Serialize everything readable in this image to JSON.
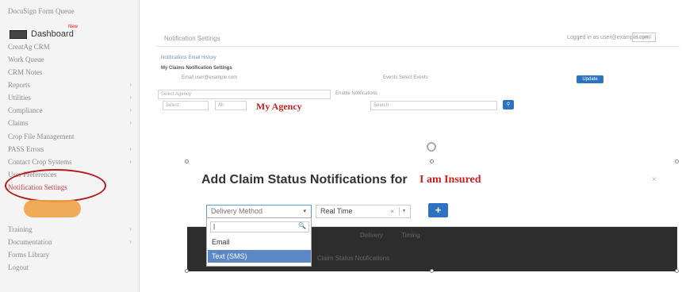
{
  "sidebar": {
    "items": [
      {
        "label": "DocuSign Form Queue",
        "chevron": false
      },
      {
        "label": "CreatAg CRM",
        "chevron": false
      },
      {
        "label": "Work Queue",
        "chevron": false
      },
      {
        "label": "CRM Notes",
        "chevron": false
      },
      {
        "label": "Reports",
        "chevron": true
      },
      {
        "label": "Utilities",
        "chevron": true
      },
      {
        "label": "Compliance",
        "chevron": true
      },
      {
        "label": "Claims",
        "chevron": true
      },
      {
        "label": "Crop File Management",
        "chevron": false
      },
      {
        "label": "PASS Errors",
        "chevron": true
      },
      {
        "label": "Contact Crop Systems",
        "chevron": true
      },
      {
        "label": "User Preferences",
        "chevron": false
      },
      {
        "label": "Notification Settings",
        "chevron": false,
        "active": true
      },
      {
        "label": "Training",
        "chevron": true
      },
      {
        "label": "Documentation",
        "chevron": true
      },
      {
        "label": "Forms Library",
        "chevron": false
      },
      {
        "label": "Logout",
        "chevron": false
      }
    ],
    "dashboard_label": "Dashboard",
    "new_badge": "New",
    "chevron_glyph": "›"
  },
  "background": {
    "page_title": "Notification Settings",
    "user_info": "Logged in as user@example.com",
    "user_button": "Logout",
    "tabs": "Notifications   Email   History",
    "section_heading": "My Claims Notification Settings",
    "email_label": "Email  user@example.com",
    "events_label": "Events  Select Events",
    "update_button": "Update",
    "input_placeholder": "Select Agency",
    "checkbox_label": "Enable Notifications",
    "small_field_1": "Select",
    "small_field_2": "All",
    "search_field": "Search",
    "my_agency": "My Agency"
  },
  "modal": {
    "title": "Add Claim Status Notifications for",
    "title_highlight": "I am Insured",
    "close_glyph": "×",
    "delivery_select": {
      "placeholder": "Delivery Method",
      "caret": "▾"
    },
    "timing_select": {
      "value": "Real Time",
      "clear": "×",
      "caret": "▾"
    },
    "add_button": "+",
    "dark_labels": [
      "Delivery",
      "Timing",
      "Claim Status Notifications"
    ],
    "dropdown": {
      "search_value": "|",
      "search_icon": "🔍",
      "options": [
        "Email",
        "Text (SMS)"
      ],
      "selected_index": 1
    }
  },
  "colors": {
    "accent_blue": "#2f72c0",
    "annotation_red": "#c81f1f",
    "highlight_option": "#5b87c4",
    "modal_dark": "#2d2d2d"
  }
}
